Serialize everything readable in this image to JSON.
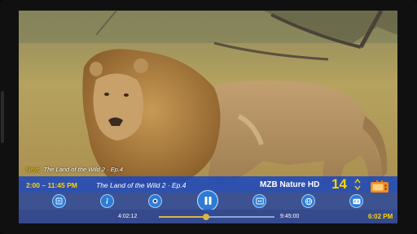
{
  "next_up": {
    "label": "Next:",
    "title": "The Land of the Wild 2 · Ep.4"
  },
  "info_bar": {
    "time_range": "2:00 – 11:45 PM",
    "program_title": "The Land of the Wild 2 · Ep.4",
    "channel_name": "MZB Nature HD",
    "channel_number": "14"
  },
  "controls": {
    "icons": [
      "list-icon",
      "info-icon",
      "record-icon",
      "pause-icon",
      "picture-in-picture-icon",
      "globe-icon",
      "closed-captions-icon"
    ]
  },
  "progress": {
    "elapsed": "4:02:12",
    "total": "9:45:00",
    "fraction": 0.41
  },
  "clock": "6:02 PM",
  "colors": {
    "accent_yellow": "#ffd400",
    "bar_blue": "#1946be",
    "button_blue": "#2e7bd6",
    "tv_icon_orange": "#f28a1e"
  }
}
